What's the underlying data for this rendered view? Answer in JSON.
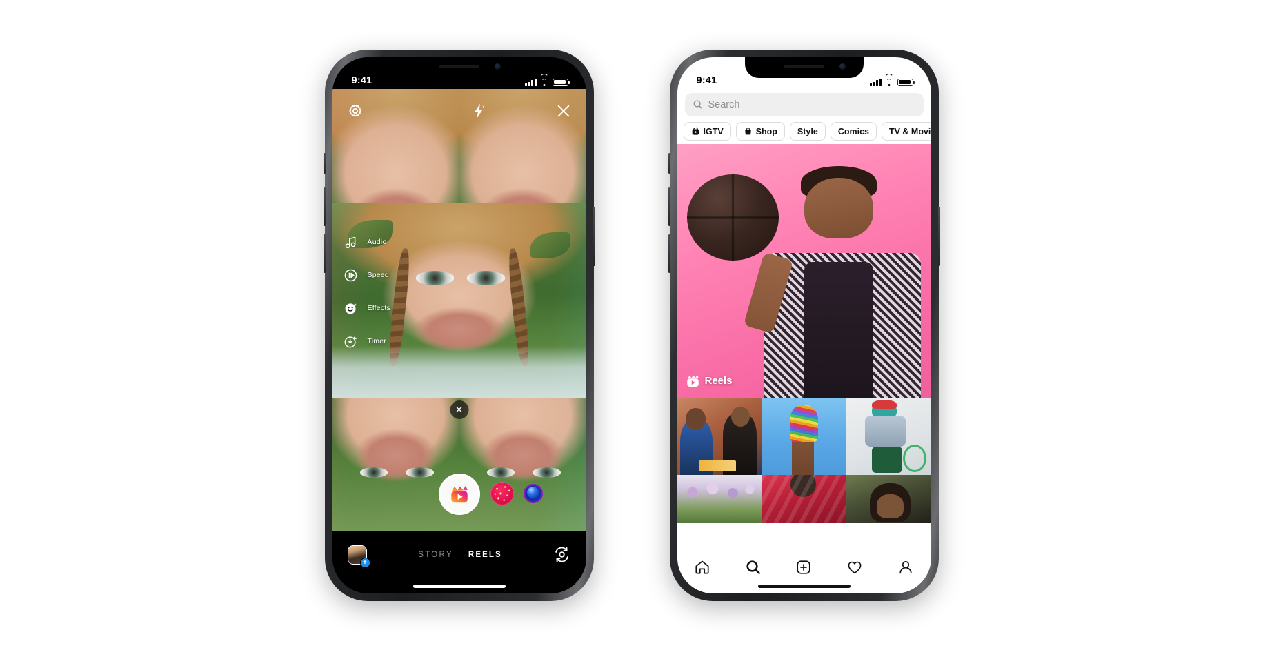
{
  "meta": {
    "background": "#ffffff"
  },
  "left_phone": {
    "name": "instagram-reels-camera",
    "statusbar": {
      "time": "9:41",
      "icons": [
        "signal-bars-icon",
        "wifi-icon",
        "battery-icon"
      ]
    },
    "top_controls": [
      {
        "name": "settings-gear-icon",
        "label": "Settings"
      },
      {
        "name": "flash-off-icon",
        "label": "Flash off"
      },
      {
        "name": "close-icon",
        "label": "Close"
      }
    ],
    "tools": [
      {
        "icon": "music-note-icon",
        "label": "Audio"
      },
      {
        "icon": "speed-icon",
        "label": "Speed"
      },
      {
        "icon": "effects-face-icon",
        "label": "Effects"
      },
      {
        "icon": "timer-icon",
        "label": "Timer"
      }
    ],
    "clear_effect_button": {
      "icon": "close-icon",
      "label": "Clear effect"
    },
    "capture": {
      "label": "Record",
      "icon": "reels-clapper-icon"
    },
    "effect_thumbnails": [
      {
        "name": "effect-sparkle-red",
        "color": "#e01050"
      },
      {
        "name": "effect-blue-orb",
        "color": "#0b2fa6"
      }
    ],
    "bottom_bar": {
      "gallery_button": {
        "name": "gallery-thumbnail",
        "badge": "+"
      },
      "modes": [
        {
          "label": "STORY",
          "active": false
        },
        {
          "label": "REELS",
          "active": true
        }
      ],
      "flip_camera": {
        "name": "flip-camera-icon",
        "label": "Flip camera"
      }
    }
  },
  "right_phone": {
    "name": "instagram-explore",
    "statusbar": {
      "time": "9:41",
      "icons": [
        "signal-bars-icon",
        "wifi-icon",
        "battery-icon"
      ]
    },
    "search": {
      "placeholder": "Search",
      "value": "",
      "icon": "search-icon"
    },
    "chips": [
      {
        "label": "IGTV",
        "icon": "igtv-icon"
      },
      {
        "label": "Shop",
        "icon": "shopping-bag-icon"
      },
      {
        "label": "Style",
        "icon": ""
      },
      {
        "label": "Comics",
        "icon": ""
      },
      {
        "label": "TV & Movies",
        "icon": ""
      }
    ],
    "hero": {
      "badge_label": "Reels",
      "badge_icon": "reels-clapper-icon",
      "background_color": "#f96ca6"
    },
    "grid": [
      [
        {
          "name": "grid-cell-workshop",
          "colors": [
            "#b8704f",
            "#2b3d5c"
          ]
        },
        {
          "name": "grid-cell-rainbow-nails",
          "colors": [
            "#63b4ea",
            "#d35fb0"
          ]
        },
        {
          "name": "grid-cell-wheelchair-style",
          "colors": [
            "#cfd4d8",
            "#2f6f4a"
          ]
        }
      ],
      [
        {
          "name": "grid-cell-flowers",
          "colors": [
            "#b9a7c9",
            "#6d8f4e"
          ]
        },
        {
          "name": "grid-cell-red-dress",
          "colors": [
            "#c4233a",
            "#7d1423"
          ]
        },
        {
          "name": "grid-cell-portrait",
          "colors": [
            "#4c4a3a",
            "#1d1a14"
          ]
        }
      ]
    ],
    "tabbar": [
      {
        "name": "tab-home",
        "icon": "home-icon",
        "active": false
      },
      {
        "name": "tab-search",
        "icon": "search-icon",
        "active": true
      },
      {
        "name": "tab-create",
        "icon": "plus-box-icon",
        "active": false
      },
      {
        "name": "tab-activity",
        "icon": "heart-icon",
        "active": false
      },
      {
        "name": "tab-profile",
        "icon": "person-icon",
        "active": false
      }
    ]
  }
}
